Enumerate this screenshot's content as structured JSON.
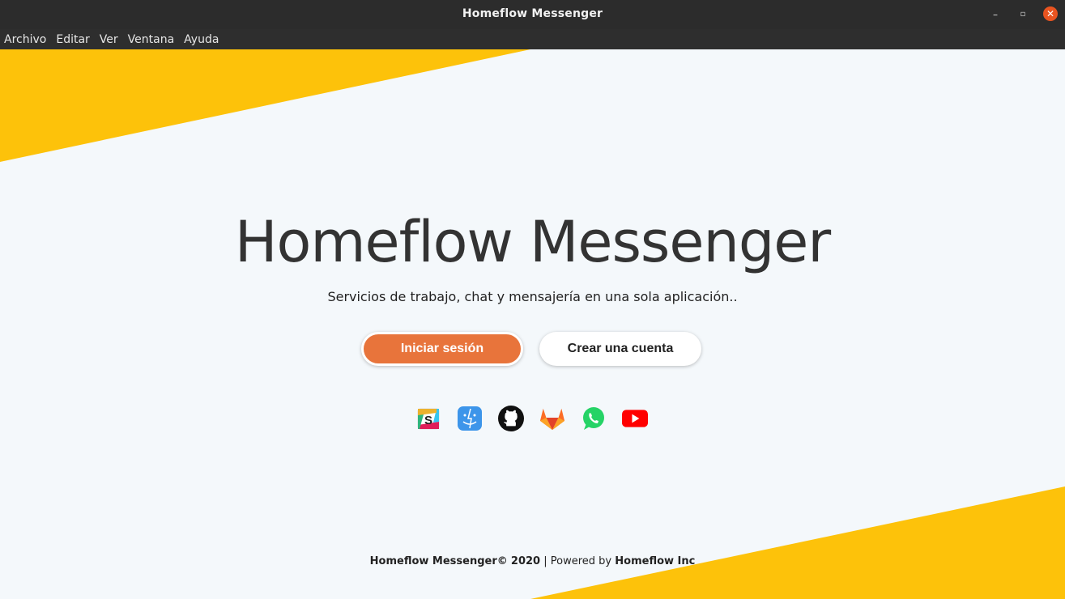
{
  "window": {
    "title": "Homeflow Messenger",
    "minimize_glyph": "–",
    "maximize_glyph": "▫",
    "close_glyph": "✕"
  },
  "menu": {
    "items": [
      "Archivo",
      "Editar",
      "Ver",
      "Ventana",
      "Ayuda"
    ]
  },
  "hero": {
    "title": "Homeflow Messenger",
    "subtitle": "Servicios de trabajo, chat y mensajería en una sola aplicación.."
  },
  "actions": {
    "login_label": "Iniciar sesión",
    "register_label": "Crear una cuenta"
  },
  "services": [
    {
      "name": "slack-icon"
    },
    {
      "name": "finder-icon"
    },
    {
      "name": "github-icon"
    },
    {
      "name": "gitlab-icon"
    },
    {
      "name": "whatsapp-icon"
    },
    {
      "name": "youtube-icon"
    }
  ],
  "footer": {
    "brand": "Homeflow Messenger",
    "copyright_symbol": "©",
    "year": "2020",
    "separator": "|",
    "powered_by": "Powered by",
    "company": "Homeflow Inc"
  },
  "colors": {
    "accent_yellow": "#fdc20a",
    "button_orange": "#e8743b",
    "background": "#f4f8fb",
    "titlebar": "#2c2c2c",
    "close_button": "#e95420"
  }
}
